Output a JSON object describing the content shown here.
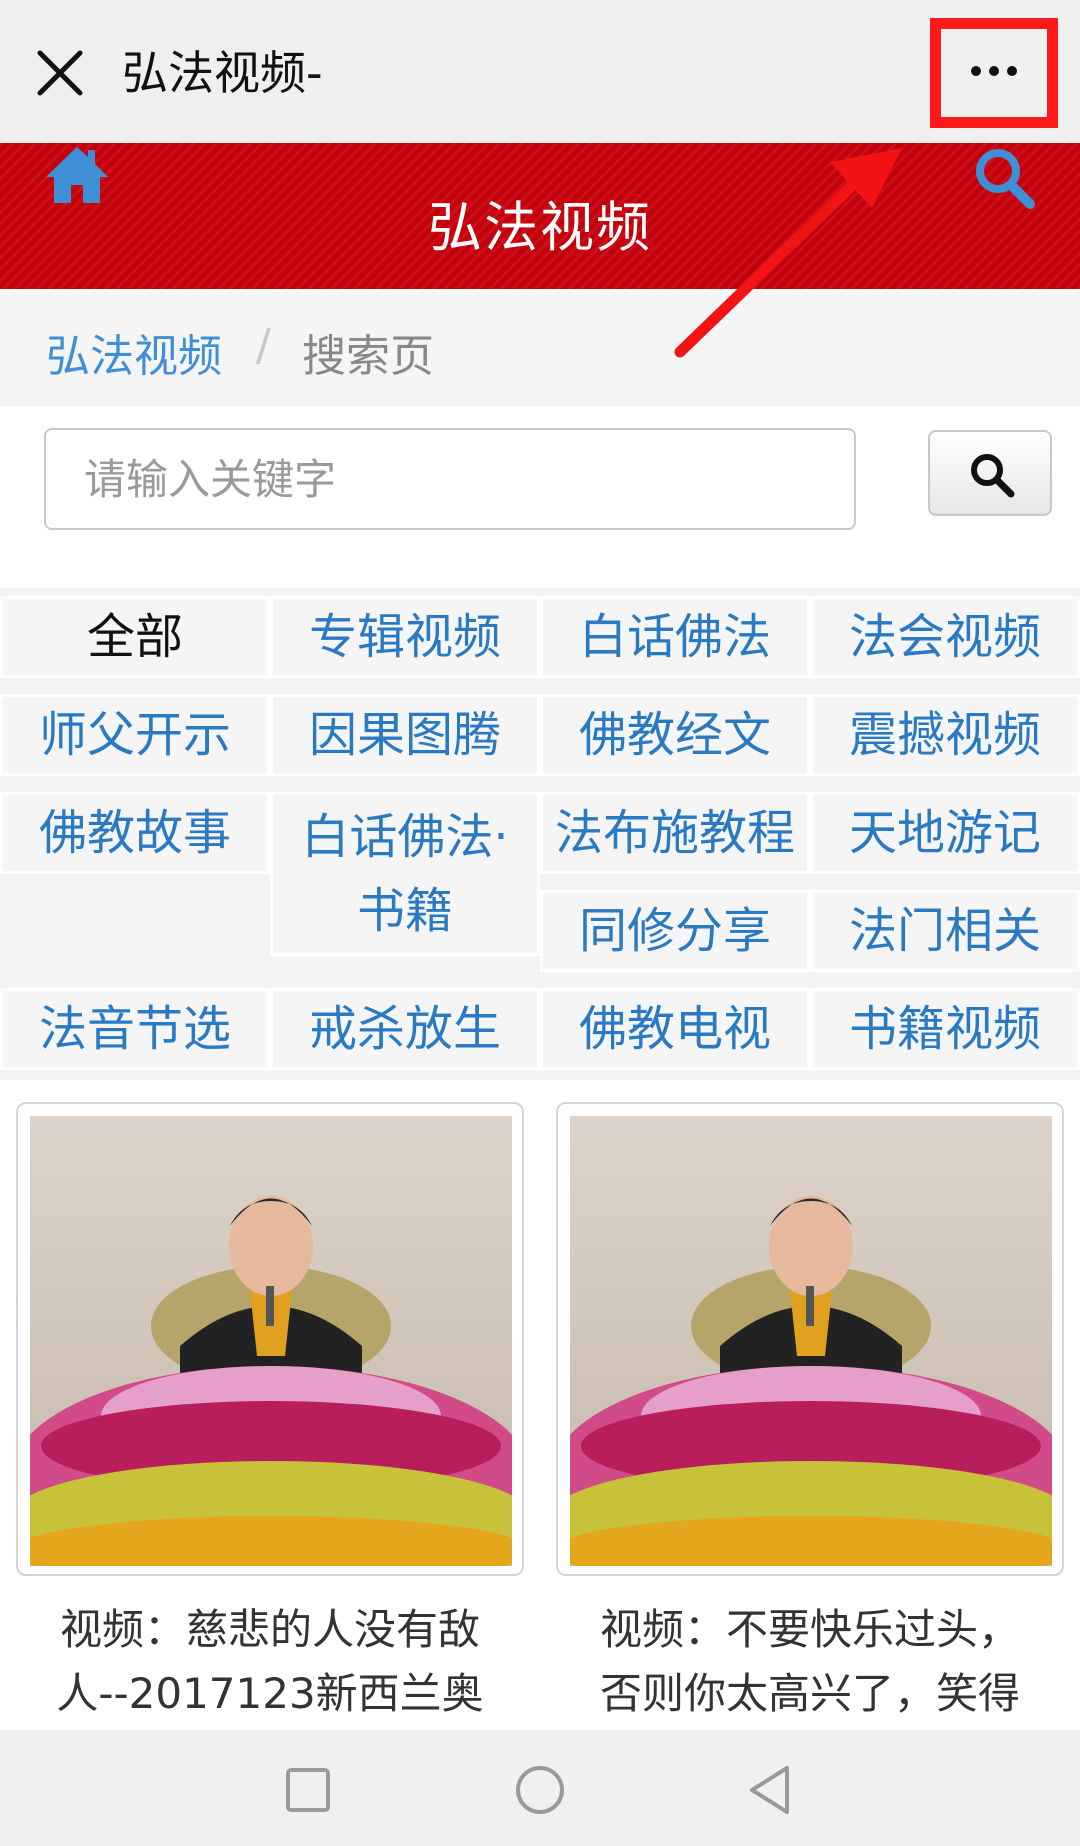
{
  "window": {
    "title": "弘法视频-"
  },
  "header": {
    "title": "弘法视频"
  },
  "breadcrumb": {
    "home": "弘法视频",
    "separator": "/",
    "current": "搜索页"
  },
  "search": {
    "placeholder": "请输入关键字"
  },
  "categories": [
    {
      "label": "全部",
      "active": true
    },
    {
      "label": "专辑视频"
    },
    {
      "label": "白话佛法"
    },
    {
      "label": "法会视频"
    },
    {
      "label": "师父开示"
    },
    {
      "label": "因果图腾"
    },
    {
      "label": "佛教经文"
    },
    {
      "label": "震撼视频"
    },
    {
      "label": "佛教故事"
    },
    {
      "label": "白话佛法·",
      "line2": "书籍"
    },
    {
      "label": "法布施教程"
    },
    {
      "label": "天地游记"
    },
    {
      "label": "同修分享"
    },
    {
      "label": "法门相关"
    },
    {
      "label": "法音节选"
    },
    {
      "label": "戒杀放生"
    },
    {
      "label": "佛教电视"
    },
    {
      "label": "书籍视频"
    }
  ],
  "videos": [
    {
      "caption_line1": "视频：慈悲的人没有敌",
      "caption_line2": "人--2017123新西兰奥"
    },
    {
      "caption_line1": "视频：不要快乐过头，",
      "caption_line2": "否则你太高兴了，笑得"
    }
  ],
  "icons": {
    "close": "close-icon",
    "more": "more-icon",
    "home": "home-icon",
    "search": "search-icon",
    "back": "back-icon",
    "home_nav": "circle-icon",
    "recent": "square-icon"
  },
  "colors": {
    "header_red": "#c9020c",
    "link_blue": "#2a7ac3",
    "accent_blue": "#3f8fd6",
    "highlight_red": "#ff1a1a"
  }
}
